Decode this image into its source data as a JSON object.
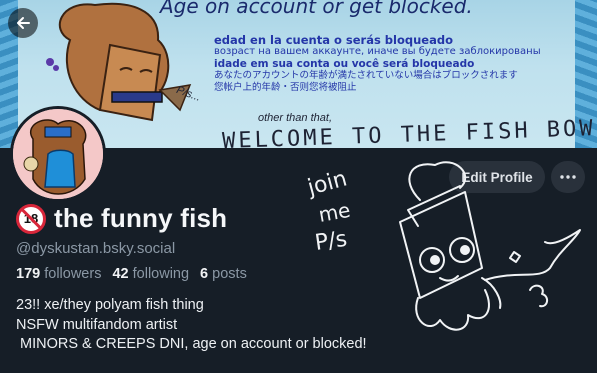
{
  "banner": {
    "top_text": "Age on account or get blocked.",
    "lines": [
      "edad en la cuenta o serás bloqueado",
      "возраст на вашем аккаунте, иначе вы будете заблокированы",
      "idade em sua conta ou você será bloqueado",
      "あなたのアカウントの年齢が満たされていない場合はブロックされます",
      "您帐户上的年龄・否则您将被阻止"
    ],
    "pls": "P/s...",
    "other": "other than that,",
    "welcome": "WELCOME TO THE FISH BOWL!"
  },
  "nav": {
    "back_icon": "arrow-left-icon"
  },
  "profile": {
    "badge_text": "18",
    "display_name": "the funny fish",
    "handle": "@dyskustan.bsky.social",
    "followers_count": "179",
    "followers_label": "followers",
    "following_count": "42",
    "following_label": "following",
    "posts_count": "6",
    "posts_label": "posts",
    "bio": "23!! xe/they polyam fish thing\nNSFW multifandom artist\n MINORS & CREEPS DNI, age on account or blocked!"
  },
  "actions": {
    "edit_profile_label": "Edit Profile",
    "more_icon": "ellipsis-icon"
  },
  "doodle": {
    "text_lines": [
      "join",
      "me",
      "P/s"
    ]
  },
  "colors": {
    "background": "#161e27",
    "button_bg": "#29313b",
    "muted_text": "#8b98a5",
    "banner_text": "#2436a8",
    "badge_red": "#d8263a"
  }
}
